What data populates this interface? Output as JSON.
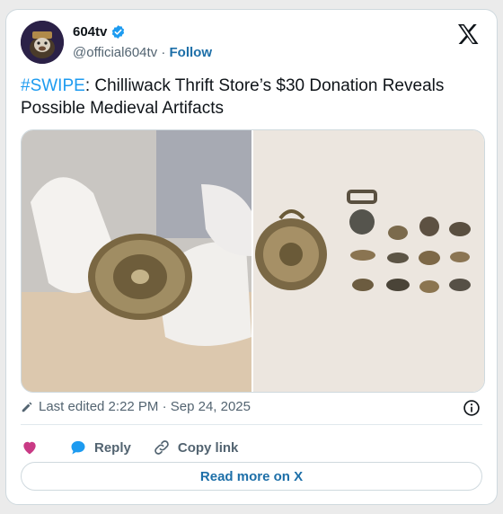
{
  "account": {
    "display_name": "604tv",
    "handle": "@official604tv",
    "separator": "·",
    "follow_label": "Follow"
  },
  "tweet": {
    "hashtag": "#SWIPE",
    "text": ": Chilliwack Thrift Store’s $30 Donation Reveals Possible Medieval Artifacts"
  },
  "meta": {
    "edited_label": "Last edited 2:22 PM · Sep 24, 2025"
  },
  "actions": {
    "reply_label": "Reply",
    "copy_label": "Copy link",
    "read_more_label": "Read more on X"
  },
  "colors": {
    "link_blue": "#1d9bf0",
    "follow_blue": "#1d6fa8",
    "like_pink": "#c93a85",
    "reply_blue": "#1d9bf0",
    "muted_gray": "#536471"
  },
  "icons": [
    "verified-badge-icon",
    "x-logo-icon",
    "pencil-icon",
    "info-icon",
    "heart-icon",
    "reply-bubble-icon",
    "link-icon"
  ]
}
